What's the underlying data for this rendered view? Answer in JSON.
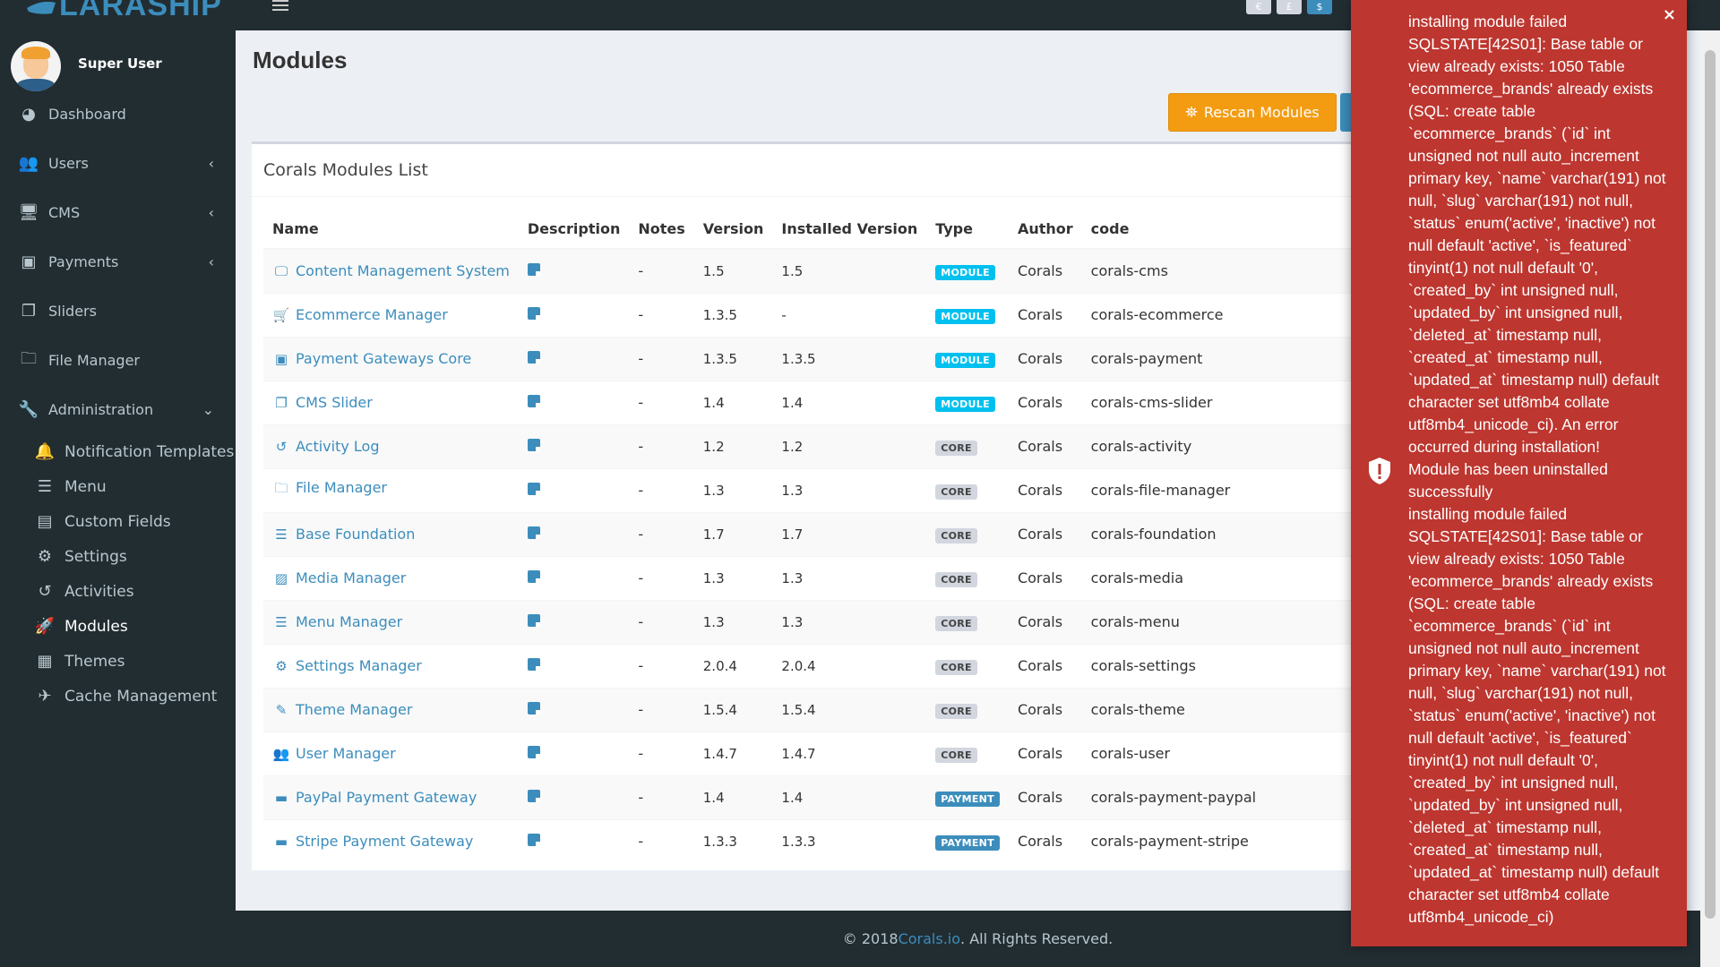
{
  "brand": {
    "logo_text": "LARASHIP"
  },
  "header": {
    "icon_labels": [
      "€",
      "£",
      "$"
    ]
  },
  "user": {
    "name": "Super User"
  },
  "sidebar": {
    "items": [
      {
        "label": "Dashboard",
        "icon": "dashboard-icon"
      },
      {
        "label": "Users",
        "icon": "users-icon",
        "chevron": "‹"
      },
      {
        "label": "CMS",
        "icon": "desktop-icon",
        "chevron": "‹"
      },
      {
        "label": "Payments",
        "icon": "money-icon",
        "chevron": "‹"
      },
      {
        "label": "Sliders",
        "icon": "copy-icon"
      },
      {
        "label": "File Manager",
        "icon": "folder-icon"
      },
      {
        "label": "Administration",
        "icon": "wrench-icon",
        "chevron": "⌄"
      }
    ],
    "sub_items": [
      {
        "label": "Notification Templates",
        "icon": "bell-icon"
      },
      {
        "label": "Menu",
        "icon": "bars-icon"
      },
      {
        "label": "Custom Fields",
        "icon": "database-icon"
      },
      {
        "label": "Settings",
        "icon": "cogs-icon"
      },
      {
        "label": "Activities",
        "icon": "history-icon"
      },
      {
        "label": "Modules",
        "icon": "rocket-icon",
        "active": true
      },
      {
        "label": "Themes",
        "icon": "themes-icon"
      },
      {
        "label": "Cache Management",
        "icon": "plane-icon"
      }
    ]
  },
  "page": {
    "title": "Modules",
    "rescan_label": "Rescan Modules",
    "box_title": "Corals Modules List"
  },
  "table": {
    "headers": [
      "Name",
      "Description",
      "Notes",
      "Version",
      "Installed Version",
      "Type",
      "Author",
      "code"
    ],
    "rows": [
      {
        "name": "Content Management System",
        "icon": "desktop-icon",
        "notes": "-",
        "version": "1.5",
        "installed": "1.5",
        "type": "MODULE",
        "author": "Corals",
        "code": "corals-cms"
      },
      {
        "name": "Ecommerce Manager",
        "icon": "cart-icon",
        "notes": "-",
        "version": "1.3.5",
        "installed": "-",
        "type": "MODULE",
        "author": "Corals",
        "code": "corals-ecommerce"
      },
      {
        "name": "Payment Gateways Core",
        "icon": "money-icon",
        "notes": "-",
        "version": "1.3.5",
        "installed": "1.3.5",
        "type": "MODULE",
        "author": "Corals",
        "code": "corals-payment"
      },
      {
        "name": "CMS Slider",
        "icon": "copy-icon",
        "notes": "-",
        "version": "1.4",
        "installed": "1.4",
        "type": "MODULE",
        "author": "Corals",
        "code": "corals-cms-slider"
      },
      {
        "name": "Activity Log",
        "icon": "history-icon",
        "notes": "-",
        "version": "1.2",
        "installed": "1.2",
        "type": "CORE",
        "author": "Corals",
        "code": "corals-activity"
      },
      {
        "name": "File Manager",
        "icon": "folder-icon",
        "notes": "-",
        "version": "1.3",
        "installed": "1.3",
        "type": "CORE",
        "author": "Corals",
        "code": "corals-file-manager"
      },
      {
        "name": "Base Foundation",
        "icon": "bars-icon",
        "notes": "-",
        "version": "1.7",
        "installed": "1.7",
        "type": "CORE",
        "author": "Corals",
        "code": "corals-foundation"
      },
      {
        "name": "Media Manager",
        "icon": "image-icon",
        "notes": "-",
        "version": "1.3",
        "installed": "1.3",
        "type": "CORE",
        "author": "Corals",
        "code": "corals-media"
      },
      {
        "name": "Menu Manager",
        "icon": "bars-icon",
        "notes": "-",
        "version": "1.3",
        "installed": "1.3",
        "type": "CORE",
        "author": "Corals",
        "code": "corals-menu"
      },
      {
        "name": "Settings Manager",
        "icon": "cogs-icon",
        "notes": "-",
        "version": "2.0.4",
        "installed": "2.0.4",
        "type": "CORE",
        "author": "Corals",
        "code": "corals-settings"
      },
      {
        "name": "Theme Manager",
        "icon": "magic-icon",
        "notes": "-",
        "version": "1.5.4",
        "installed": "1.5.4",
        "type": "CORE",
        "author": "Corals",
        "code": "corals-theme"
      },
      {
        "name": "User Manager",
        "icon": "users-icon",
        "notes": "-",
        "version": "1.4.7",
        "installed": "1.4.7",
        "type": "CORE",
        "author": "Corals",
        "code": "corals-user"
      },
      {
        "name": "PayPal Payment Gateway",
        "icon": "paypal-icon",
        "notes": "-",
        "version": "1.4",
        "installed": "1.4",
        "type": "PAYMENT",
        "author": "Corals",
        "code": "corals-payment-paypal"
      },
      {
        "name": "Stripe Payment Gateway",
        "icon": "stripe-icon",
        "notes": "-",
        "version": "1.3.3",
        "installed": "1.3.3",
        "type": "PAYMENT",
        "author": "Corals",
        "code": "corals-payment-stripe"
      }
    ]
  },
  "footer": {
    "prefix": "© 2018 ",
    "link": "Corals.io",
    "suffix": ". All Rights Reserved."
  },
  "toast": {
    "close": "×",
    "message": "installing module failed SQLSTATE[42S01]: Base table or view already exists: 1050 Table 'ecommerce_brands' already exists (SQL: create table `ecommerce_brands` (`id` int unsigned not null auto_increment primary key, `name` varchar(191) not null, `slug` varchar(191) not null, `status` enum('active', 'inactive') not null default 'active', `is_featured` tinyint(1) not null default '0', `created_by` int unsigned null, `updated_by` int unsigned null, `deleted_at` timestamp null, `created_at` timestamp null, `updated_at` timestamp null) default character set utf8mb4 collate utf8mb4_unicode_ci). An error occurred during installation!\nModule has been uninstalled successfully\ninstalling module failed SQLSTATE[42S01]: Base table or view already exists: 1050 Table 'ecommerce_brands' already exists (SQL: create table `ecommerce_brands` (`id` int unsigned not null auto_increment primary key, `name` varchar(191) not null, `slug` varchar(191) not null, `status` enum('active', 'inactive') not null default 'active', `is_featured` tinyint(1) not null default '0', `created_by` int unsigned null, `updated_by` int unsigned null, `deleted_at` timestamp null, `created_at` timestamp null, `updated_at` timestamp null) default character set utf8mb4 collate utf8mb4_unicode_ci)"
  },
  "colors": {
    "sidebar_bg": "#222d32",
    "accent": "#3c8dbc",
    "warning": "#f39c12",
    "error": "#bd362f",
    "info": "#00c0ef"
  }
}
